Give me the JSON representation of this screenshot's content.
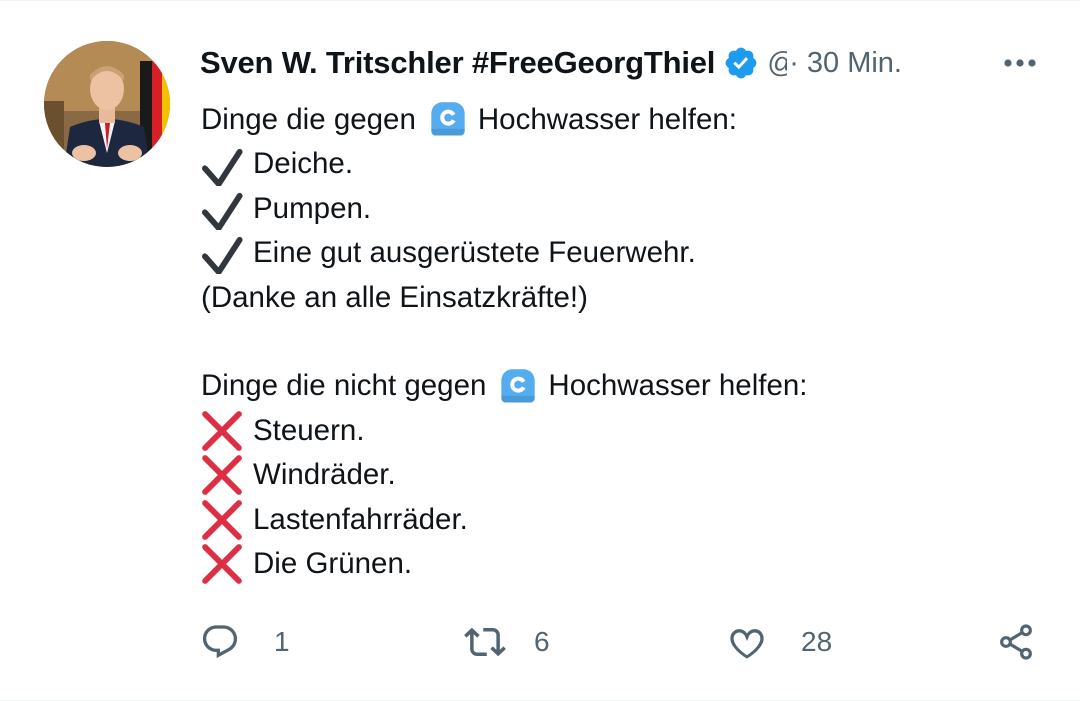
{
  "tweet": {
    "author_name": "Sven W. Tritschler #FreeGeorgThiel",
    "handle": "@",
    "separator": "·",
    "time": "30 Min.",
    "verified_color": "#1d9bf0",
    "lines": [
      {
        "icon": "",
        "pre": "Dinge die gegen",
        "post": "Hochwasser helfen:",
        "wave": "wave-emoji"
      },
      {
        "icon": "check-mark-icon",
        "text": "Deiche."
      },
      {
        "icon": "check-mark-icon",
        "text": "Pumpen."
      },
      {
        "icon": "check-mark-icon",
        "text": "Eine gut ausgerüstete Feuerwehr."
      },
      {
        "icon": "",
        "text": "(Danke an alle Einsatzkräfte!)"
      },
      {
        "icon": "",
        "pre": "Dinge die nicht gegen",
        "post": "Hochwasser helfen:",
        "wave": "wave-emoji"
      },
      {
        "icon": "cross-mark-icon",
        "text": "Steuern."
      },
      {
        "icon": "cross-mark-icon",
        "text": "Windräder."
      },
      {
        "icon": "cross-mark-icon",
        "text": "Lastenfahrräder."
      },
      {
        "icon": "cross-mark-icon",
        "text": "Die Grünen."
      }
    ],
    "actions": {
      "reply_count": "1",
      "retweet_count": "6",
      "like_count": "28"
    },
    "colors": {
      "cross": "#dd2e44",
      "wave": "#55acee",
      "muted": "#536471"
    }
  }
}
